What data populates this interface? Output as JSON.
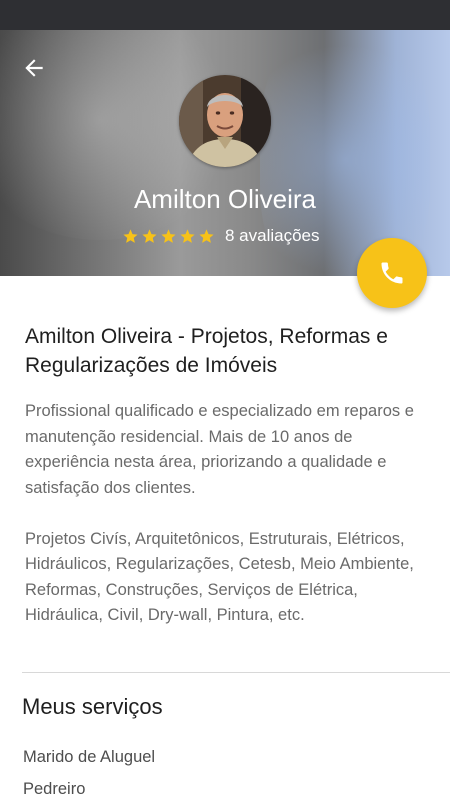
{
  "colors": {
    "accent": "#f7c218",
    "star": "#f7c218",
    "status_bar": "#2e2f33",
    "title_text": "#1f1f1f",
    "body_text": "#6a6a6a"
  },
  "header": {
    "back_icon": "arrow-left-icon",
    "profile_name": "Amilton Oliveira",
    "rating_stars": 5,
    "reviews_label": "8 avaliações",
    "call_icon": "phone-icon"
  },
  "main": {
    "title": "Amilton Oliveira - Projetos, Reformas e Regularizações de Imóveis",
    "description": [
      "Profissional qualificado e especializado em reparos e manutenção residencial. Mais de 10 anos de experiência nesta área, priorizando a qualidade e satisfação dos clientes.",
      "Projetos Civís, Arquitetônicos, Estruturais, Elétricos, Hidráulicos, Regularizações, Cetesb, Meio Ambiente, Reformas, Construções, Serviços de Elétrica, Hidráulica, Civil, Dry-wall, Pintura, etc."
    ]
  },
  "services": {
    "heading": "Meus serviços",
    "items": [
      "Marido de Aluguel",
      "Pedreiro"
    ]
  }
}
